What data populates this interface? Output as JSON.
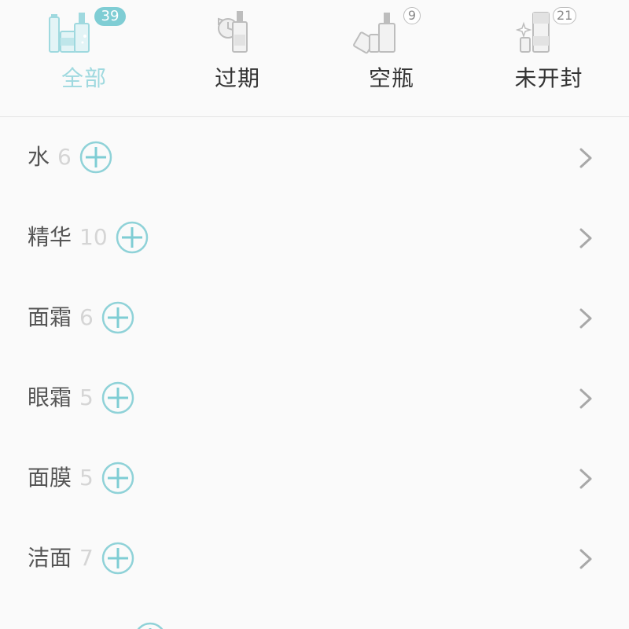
{
  "tabs": [
    {
      "key": "all",
      "label": "全部",
      "badge": "39",
      "badge_style": "filled",
      "active": true,
      "icon": "cosmetics-set-icon"
    },
    {
      "key": "expired",
      "label": "过期",
      "badge": "",
      "badge_style": "none",
      "active": false,
      "icon": "expired-bottle-icon"
    },
    {
      "key": "empty",
      "label": "空瓶",
      "badge": "9",
      "badge_style": "outline",
      "active": false,
      "icon": "empty-bottle-icon"
    },
    {
      "key": "unopened",
      "label": "未开封",
      "badge": "21",
      "badge_style": "outline",
      "active": false,
      "icon": "unopened-bottle-icon"
    }
  ],
  "categories": [
    {
      "label": "水",
      "count": "6"
    },
    {
      "label": "精华",
      "count": "10"
    },
    {
      "label": "面霜",
      "count": "6"
    },
    {
      "label": "眼霜",
      "count": "5"
    },
    {
      "label": "面膜",
      "count": "5"
    },
    {
      "label": "洁面",
      "count": "7"
    }
  ],
  "colors": {
    "accent": "#7fcdd4",
    "accent_light": "#9fd9df",
    "text": "#555555",
    "count": "#d5d5d5",
    "icon_gray": "#b8b8b8"
  }
}
